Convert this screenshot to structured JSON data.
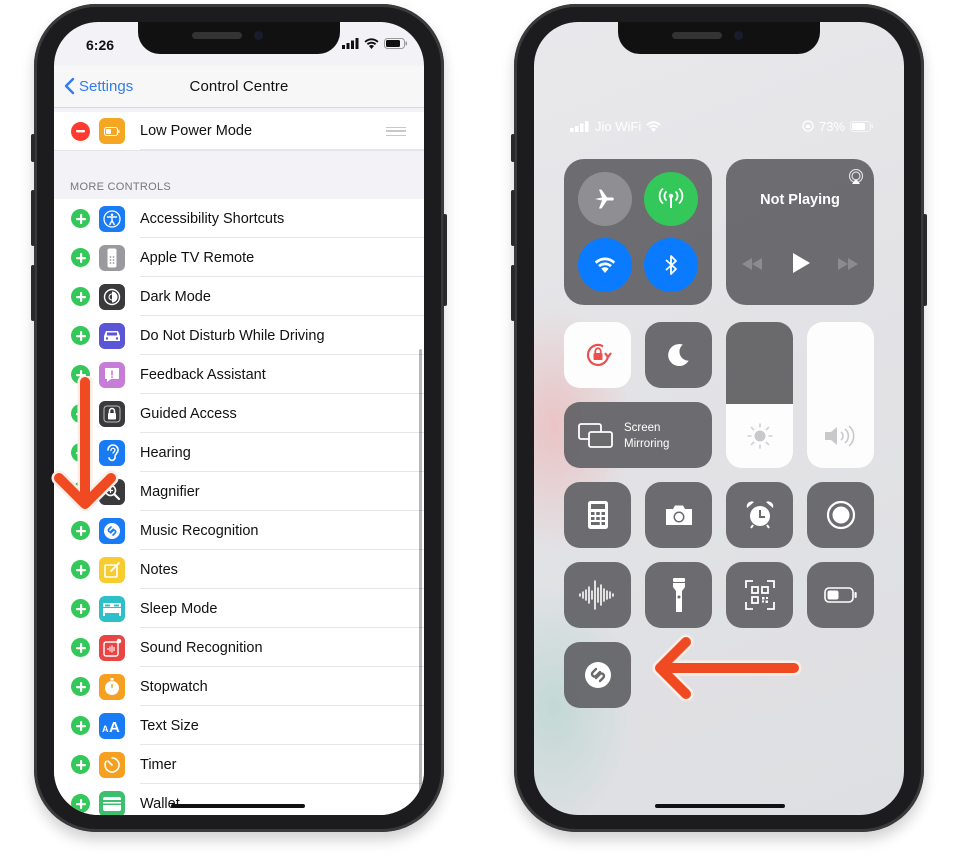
{
  "left_phone": {
    "status_bar": {
      "time": "6:26"
    },
    "nav": {
      "back_label": "Settings",
      "title": "Control Centre"
    },
    "included_controls": [
      {
        "label": "Low Power Mode",
        "icon": "battery-icon",
        "color": "#f5a623"
      }
    ],
    "section_header": "MORE CONTROLS",
    "more_controls": [
      {
        "label": "Accessibility Shortcuts",
        "icon": "accessibility-icon",
        "color": "#1a7cf5"
      },
      {
        "label": "Apple TV Remote",
        "icon": "remote-icon",
        "color": "#9a9a9e"
      },
      {
        "label": "Dark Mode",
        "icon": "dark-mode-icon",
        "color": "#3a3a3c"
      },
      {
        "label": "Do Not Disturb While Driving",
        "icon": "car-icon",
        "color": "#5b56d6"
      },
      {
        "label": "Feedback Assistant",
        "icon": "feedback-icon",
        "color": "#c77dd8"
      },
      {
        "label": "Guided Access",
        "icon": "lock-icon",
        "color": "#3a3a3c"
      },
      {
        "label": "Hearing",
        "icon": "ear-icon",
        "color": "#1a7cf5"
      },
      {
        "label": "Magnifier",
        "icon": "magnifier-icon",
        "color": "#3a3a3c"
      },
      {
        "label": "Music Recognition",
        "icon": "shazam-icon",
        "color": "#1a7cf5"
      },
      {
        "label": "Notes",
        "icon": "notes-icon",
        "color": "#f7cc2f"
      },
      {
        "label": "Sleep Mode",
        "icon": "bed-icon",
        "color": "#2ec0c8"
      },
      {
        "label": "Sound Recognition",
        "icon": "sound-recognition-icon",
        "color": "#e84545"
      },
      {
        "label": "Stopwatch",
        "icon": "stopwatch-icon",
        "color": "#f5a020"
      },
      {
        "label": "Text Size",
        "icon": "text-size-icon",
        "color": "#1a7cf5"
      },
      {
        "label": "Timer",
        "icon": "timer-icon",
        "color": "#f5a020"
      },
      {
        "label": "Wallet",
        "icon": "wallet-icon",
        "color": "#3cbf6e"
      }
    ]
  },
  "right_phone": {
    "status_bar": {
      "carrier": "Jio WiFi",
      "battery": "73%"
    },
    "connectivity": {
      "airplane_mode": {
        "on": false,
        "color": "#8e8e93"
      },
      "cellular_data": {
        "on": true,
        "color": "#34c759"
      },
      "wifi": {
        "on": true,
        "color": "#0a7bff"
      },
      "bluetooth": {
        "on": true,
        "color": "#0a7bff"
      }
    },
    "now_playing": {
      "title": "Not Playing"
    },
    "screen_mirroring": {
      "line1": "Screen",
      "line2": "Mirroring"
    },
    "brightness_percent": 44,
    "volume_percent": 100,
    "controls": [
      "orientation-lock",
      "do-not-disturb",
      "calculator",
      "camera",
      "alarm",
      "screen-recording",
      "voice-memos",
      "flashlight",
      "code-scanner",
      "low-power-mode",
      "music-recognition"
    ]
  },
  "colors": {
    "annotation_arrow": "#f04a23",
    "accent_blue": "#2f7cf6"
  }
}
